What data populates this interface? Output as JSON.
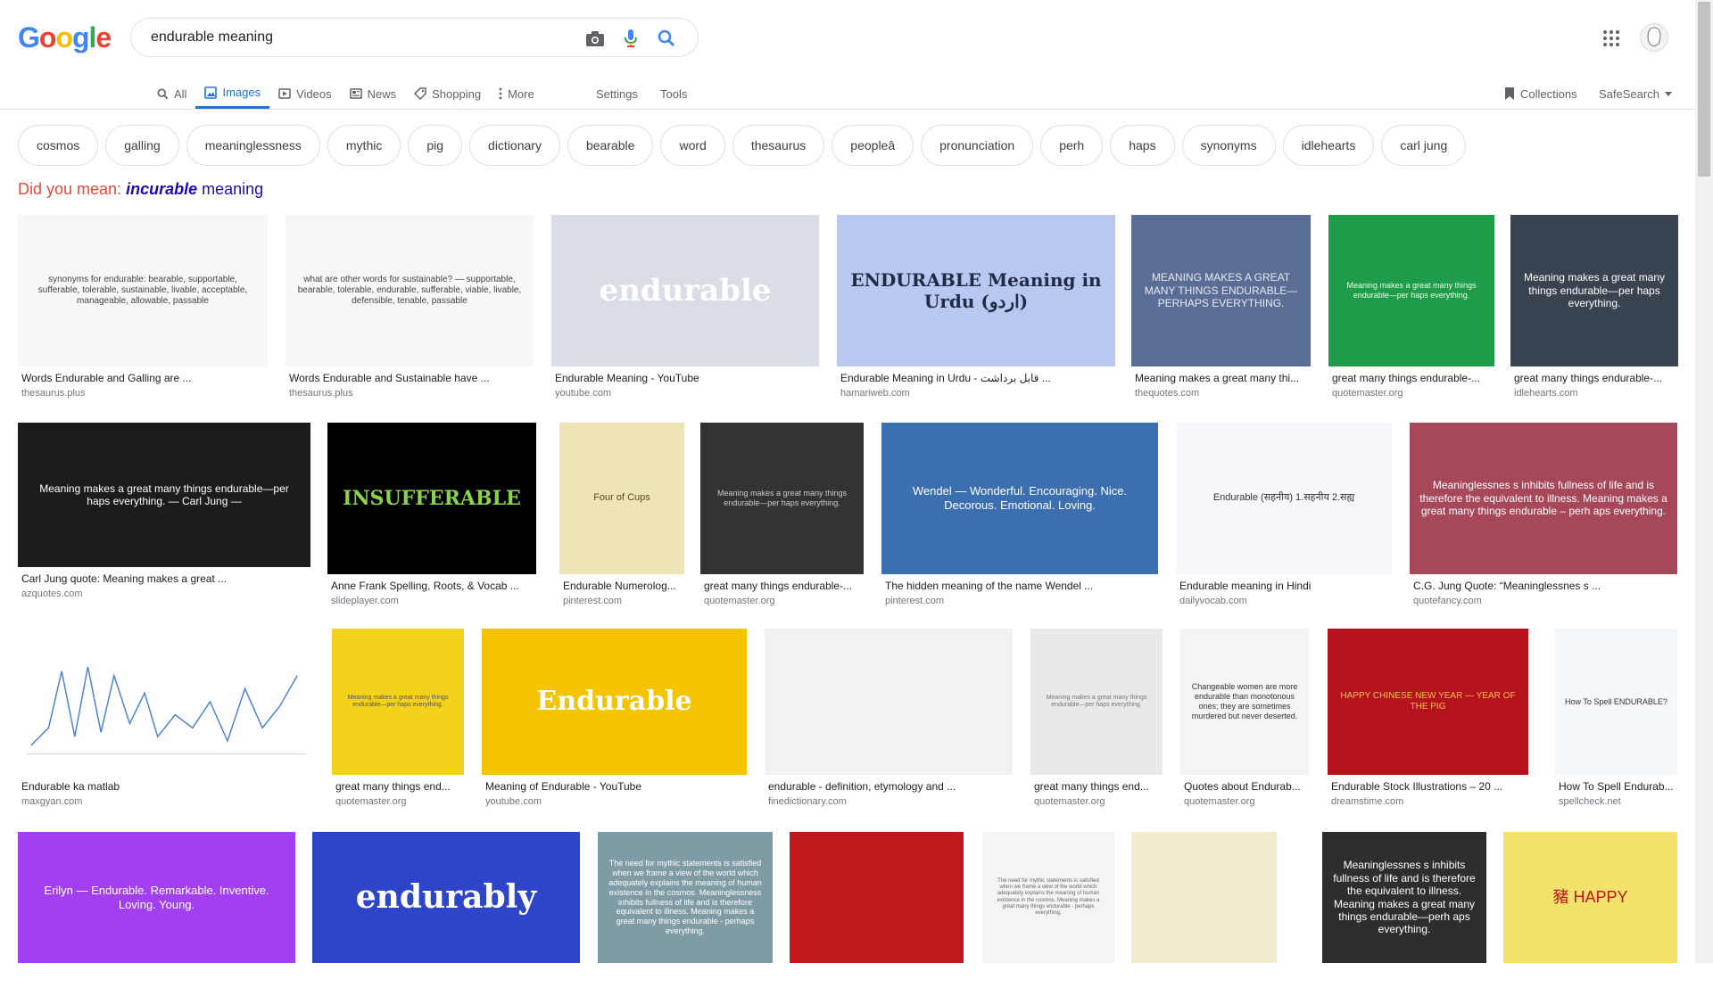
{
  "logo": "Google",
  "search": {
    "query": "endurable meaning"
  },
  "tabs": [
    {
      "label": "All",
      "icon": "search-icon"
    },
    {
      "label": "Images",
      "icon": "image-icon"
    },
    {
      "label": "Videos",
      "icon": "video-icon"
    },
    {
      "label": "News",
      "icon": "news-icon"
    },
    {
      "label": "Shopping",
      "icon": "tag-icon"
    },
    {
      "label": "More",
      "icon": "dots-vertical-icon"
    }
  ],
  "tools": {
    "settings": "Settings",
    "tools": "Tools"
  },
  "right": {
    "collections": "Collections",
    "safesearch": "SafeSearch"
  },
  "chips": [
    "cosmos",
    "galling",
    "meaninglessness",
    "mythic",
    "pig",
    "dictionary",
    "bearable",
    "word",
    "thesaurus",
    "peopleâ",
    "pronunciation",
    "perh",
    "haps",
    "synonyms",
    "idlehearts",
    "carl jung"
  ],
  "did_you_mean": {
    "prefix": "Did you mean:",
    "bold": "incurable",
    "rest": " meaning"
  },
  "results": [
    {
      "caption": "Words Endurable and Galling are ...",
      "source": "thesaurus.plus",
      "text": "synonyms for endurable: bearable, supportable, sufferable, tolerable, sustainable, livable, acceptable, manageable, allowable, passable",
      "bg": "#f7f7f7",
      "fg": "#444"
    },
    {
      "caption": "Words Endurable and Sustainable have ...",
      "source": "thesaurus.plus",
      "text": "what are other words for sustainable? — supportable, bearable, tolerable, endurable, sufferable, viable, livable, defensible, tenable, passable",
      "bg": "#f7f7f7",
      "fg": "#444"
    },
    {
      "caption": "Endurable Meaning - YouTube",
      "source": "youtube.com",
      "text": "endurable",
      "bg": "#d9dde6",
      "fg": "#ffffff"
    },
    {
      "caption": "Endurable Meaning in Urdu - قابل برداشت ...",
      "source": "hamariweb.com",
      "text": "ENDURABLE Meaning in Urdu (اردو)",
      "bg": "#b8c8f0",
      "fg": "#1f2a44"
    },
    {
      "caption": "Meaning makes a great many thi...",
      "source": "thequotes.com",
      "text": "MEANING MAKES A GREAT MANY THINGS ENDURABLE—PERHAPS EVERYTHING.",
      "bg": "#5a6d94",
      "fg": "#e8eaf2"
    },
    {
      "caption": "great many things endurable-...",
      "source": "quotemaster.org",
      "text": "Meaning makes a great many things endurable—per haps everything.",
      "bg": "#1f9c49",
      "fg": "#e8ffe8"
    },
    {
      "caption": "great many things endurable-...",
      "source": "idlehearts.com",
      "text": "Meaning makes a great many things endurable—per haps everything.",
      "bg": "#3a4450",
      "fg": "#ffffff"
    },
    {
      "caption": "Carl Jung quote: Meaning makes a great ...",
      "source": "azquotes.com",
      "text": "Meaning makes a great many things endurable—per haps everything. — Carl Jung —",
      "bg": "#1c1c1c",
      "fg": "#ffffff"
    },
    {
      "caption": "Anne Frank Spelling, Roots, & Vocab ...",
      "source": "slideplayer.com",
      "text": "INSUFFERABLE",
      "bg": "#000000",
      "fg": "#8bd34a"
    },
    {
      "caption": "Endurable Numerolog...",
      "source": "pinterest.com",
      "text": "Four of Cups",
      "bg": "#efe3b8",
      "fg": "#5a4a20"
    },
    {
      "caption": "great many things endurable-...",
      "source": "quotemaster.org",
      "text": "Meaning makes a great many things endurable—per haps everything.",
      "bg": "#333333",
      "fg": "#cccccc"
    },
    {
      "caption": "The hidden meaning of the name Wendel ...",
      "source": "pinterest.com",
      "text": "Wendel — Wonderful. Encouraging. Nice. Decorous. Emotional. Loving.",
      "bg": "#3b6fb0",
      "fg": "#ffffff"
    },
    {
      "caption": "Endurable meaning in Hindi",
      "source": "dailyvocab.com",
      "text": "Endurable (सहनीय) 1.सहनीय 2.सह्य",
      "bg": "#f6f8fb",
      "fg": "#333"
    },
    {
      "caption": "C.G. Jung Quote: “Meaninglessnes s ...",
      "source": "quotefancy.com",
      "text": "Meaninglessnes s inhibits fullness of life and is therefore the equivalent to illness. Meaning makes a great many things endurable – perh aps everything.",
      "bg": "#a6485a",
      "fg": "#ffffff"
    },
    {
      "caption": "Endurable ka matlab",
      "source": "maxgyan.com",
      "text": "",
      "bg": "#ffffff",
      "fg": "#333"
    },
    {
      "caption": "great many things end...",
      "source": "quotemaster.org",
      "text": "Meaning makes a great many things endurable—per haps everything.",
      "bg": "#f2d21b",
      "fg": "#555"
    },
    {
      "caption": "Meaning of Endurable - YouTube",
      "source": "youtube.com",
      "text": "Endurable",
      "bg": "#f5c400",
      "fg": "#ffffff"
    },
    {
      "caption": "endurable - definition, etymology and ...",
      "source": "finedictionary.com",
      "text": "",
      "bg": "#f2f2f2",
      "fg": "#111"
    },
    {
      "caption": "great many things end...",
      "source": "quotemaster.org",
      "text": "Meaning makes a great many things endurable—per haps everything.",
      "bg": "#e9e9e9",
      "fg": "#777"
    },
    {
      "caption": "Quotes about Endurab...",
      "source": "quotemaster.org",
      "text": "Changeable women are more endurable than monotonous ones; they are sometimes murdered but never deserted.",
      "bg": "#f4f4f4",
      "fg": "#333"
    },
    {
      "caption": "Endurable Stock Illustrations – 20 ...",
      "source": "dreamstime.com",
      "text": "HAPPY CHINESE NEW YEAR — YEAR OF THE PIG",
      "bg": "#b5121b",
      "fg": "#f2c14e"
    },
    {
      "caption": "How To Spell Endurab...",
      "source": "spellcheck.net",
      "text": "How To Spell ENDURABLE?",
      "bg": "#f5f8fb",
      "fg": "#333"
    },
    {
      "caption": "",
      "source": "",
      "text": "Erilyn — Endurable. Remarkable. Inventive. Loving. Young.",
      "bg": "#a23ff0",
      "fg": "#ffffff"
    },
    {
      "caption": "",
      "source": "",
      "text": "endurably",
      "bg": "#2f45c8",
      "fg": "#ffffff"
    },
    {
      "caption": "",
      "source": "",
      "text": "The need for mythic statements is satisfied when we frame a view of the world which adequately explains the meaning of human existence in the cosmos. Meaninglessness inhibits fullness of life and is therefore equivalent to illness. Meaning makes a great many things endurable - perhaps everything.",
      "bg": "#7f9ca4",
      "fg": "#ffffff"
    },
    {
      "caption": "",
      "source": "",
      "text": "",
      "bg": "#c0171d",
      "fg": "#f3b737"
    },
    {
      "caption": "",
      "source": "",
      "text": "The need for mythic statements is satisfied when we frame a view of the world which adequately explains the meaning of human existence in the cosmos. Meaning makes a great many things endurable - perhaps everything.",
      "bg": "#f4f4f4",
      "fg": "#666"
    },
    {
      "caption": "",
      "source": "",
      "text": "",
      "bg": "#f1ecd0",
      "fg": "#555"
    },
    {
      "caption": "",
      "source": "",
      "text": "Meaninglessnes s inhibits fullness of life and is therefore the equivalent to illness. Meaning makes a great many things endurable—perh aps everything.",
      "bg": "#2e2e2e",
      "fg": "#ffffff"
    },
    {
      "caption": "",
      "source": "",
      "text": "豬 HAPPY",
      "bg": "#f3e36a",
      "fg": "#c0171d"
    }
  ]
}
